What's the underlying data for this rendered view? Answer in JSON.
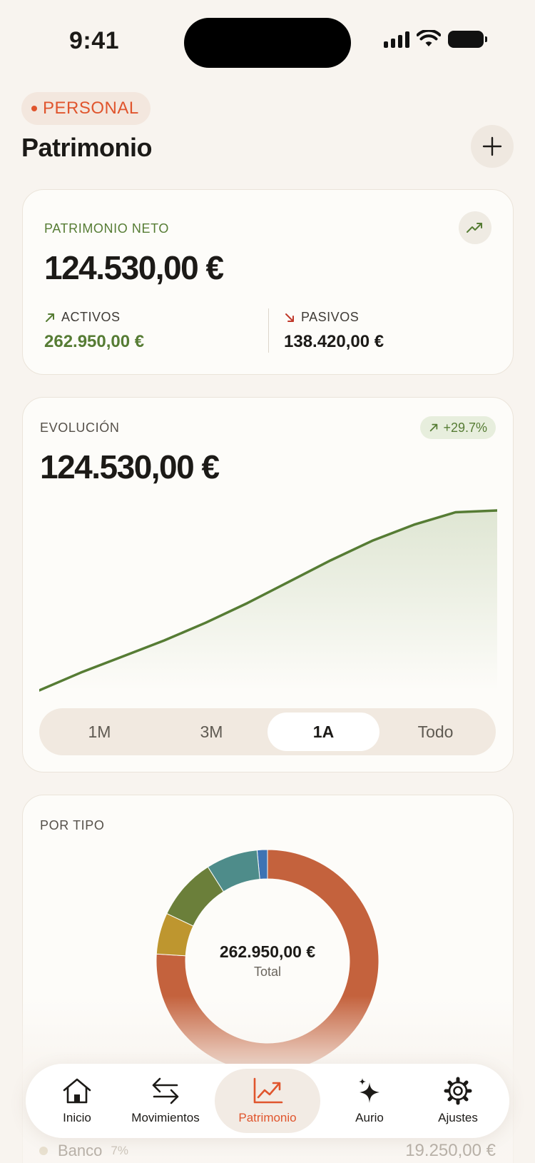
{
  "status_bar": {
    "time": "9:41"
  },
  "header": {
    "context_pill": "PERSONAL",
    "title": "Patrimonio",
    "add_button_label": "+"
  },
  "net_worth_card": {
    "label": "PATRIMONIO NETO",
    "amount": "124.530,00 €",
    "assets": {
      "label": "ACTIVOS",
      "value": "262.950,00 €"
    },
    "liabilities": {
      "label": "PASIVOS",
      "value": "138.420,00 €"
    }
  },
  "evolution_card": {
    "label": "EVOLUCIÓN",
    "change": "+29.7%",
    "amount": "124.530,00 €",
    "periods": [
      "1M",
      "3M",
      "1A",
      "Todo"
    ],
    "active_period": "1A",
    "colors": {
      "line": "#567c34",
      "fill": "#dfe6d3"
    }
  },
  "chart_data": {
    "type": "area",
    "x": [
      0,
      1,
      2,
      3,
      4,
      5,
      6,
      7,
      8,
      9,
      10,
      11
    ],
    "values": [
      0.0,
      0.1,
      0.19,
      0.28,
      0.38,
      0.49,
      0.61,
      0.73,
      0.84,
      0.93,
      1.0,
      1.01
    ],
    "ylim": [
      0,
      1.01
    ],
    "grid": false,
    "series": [
      {
        "color": "#567c34"
      }
    ]
  },
  "by_type_card": {
    "label": "POR TIPO",
    "total": "262.950,00 €",
    "total_label": "Total",
    "segments": [
      {
        "share": 0.015,
        "color": "#3e73b3"
      },
      {
        "share": 0.76,
        "color": "#c4623d"
      },
      {
        "share": 0.06,
        "color": "#be962f"
      },
      {
        "share": 0.09,
        "color": "#6b7f3a"
      },
      {
        "share": 0.075,
        "color": "#4e8c8a"
      }
    ]
  },
  "peek_row": {
    "label": "Banco",
    "percent": "7%",
    "amount": "19.250,00 €"
  },
  "tabbar": {
    "items": [
      {
        "label": "Inicio",
        "icon": "home-icon"
      },
      {
        "label": "Movimientos",
        "icon": "transfer-arrows-icon"
      },
      {
        "label": "Patrimonio",
        "icon": "chart-trend-icon"
      },
      {
        "label": "Aurio",
        "icon": "sparkles-icon"
      },
      {
        "label": "Ajustes",
        "icon": "gear-icon"
      }
    ],
    "active": "Patrimonio",
    "accent": "#e0552d"
  }
}
